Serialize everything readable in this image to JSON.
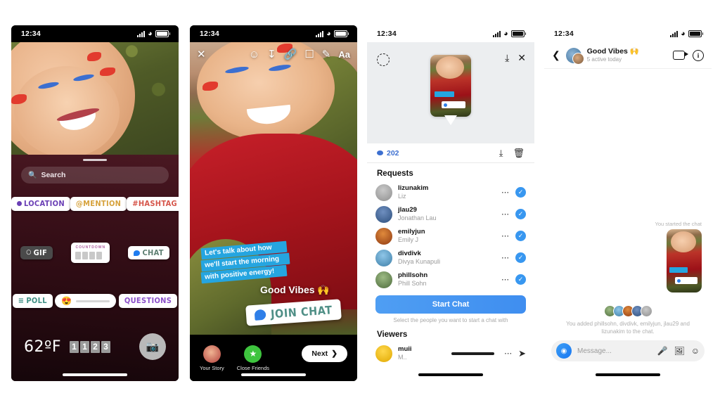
{
  "status_bar": {
    "time": "12:34"
  },
  "phone1": {
    "name": "story-camera-sticker-tray",
    "search": {
      "placeholder": "Search",
      "icon": "search-icon"
    },
    "stickers_row1": [
      {
        "label": "LOCATION",
        "icon": "location-pin-icon",
        "color": "#6a3fb5"
      },
      {
        "label": "@MENTION",
        "color": "#d6a23c"
      },
      {
        "label": "#HASHTAG",
        "color": "#d6564b"
      }
    ],
    "stickers_row2": [
      {
        "label": "GIF",
        "icon": "search-icon",
        "color": "#ffffff"
      },
      {
        "label": "COUNTDOWN",
        "color": "#b05fa0"
      },
      {
        "label": "CHAT",
        "icon": "chat-bubble-icon",
        "color": "#5e7f72"
      }
    ],
    "stickers_row3": [
      {
        "label": "POLL",
        "color": "#3f8f84"
      },
      {
        "label": "",
        "emoji": "😍"
      },
      {
        "label": "QUESTIONS",
        "color": "#8b4fc9"
      }
    ],
    "temperature": "62ºF",
    "clock_digits": [
      "1",
      "1",
      "2",
      "3"
    ],
    "shutter_icon": "camera-icon"
  },
  "phone2": {
    "name": "story-editor",
    "toolbar": {
      "close": "✕",
      "icons": [
        "smiley-face-icon",
        "download-icon",
        "link-icon",
        "sticker-icon",
        "draw-pen-icon"
      ],
      "text_tool": "Aa"
    },
    "text_sticker_lines": [
      "Let's talk about how",
      "we'll start the morning",
      "with positive energy!"
    ],
    "title_sticker": "Good Vibes 🙌",
    "join_chat_label": "JOIN CHAT",
    "footer": {
      "your_story": "Your Story",
      "close_friends": "Close Friends",
      "next": "Next"
    }
  },
  "phone3": {
    "name": "story-viewers-sheet",
    "top_icons": {
      "left": "sticker-circle-icon",
      "save": "save-story-icon",
      "close": "close-icon"
    },
    "view_count": "202",
    "bar_icons": [
      "download-icon",
      "trash-icon"
    ],
    "requests_header": "Requests",
    "requests": [
      {
        "username": "lizunakim",
        "fullname": "Liz"
      },
      {
        "username": "jlau29",
        "fullname": "Jonathan Lau"
      },
      {
        "username": "emilyjun",
        "fullname": "Emily J"
      },
      {
        "username": "divdivk",
        "fullname": "Divya Kunapuli"
      },
      {
        "username": "phillsohn",
        "fullname": "Phill Sohn"
      }
    ],
    "start_chat_label": "Start Chat",
    "hint": "Select the people you want to start a chat with",
    "viewers_header": "Viewers",
    "viewers": [
      {
        "username": "muii",
        "fullname": "M.."
      }
    ]
  },
  "phone4": {
    "name": "group-chat",
    "back_icon": "chevron-left-icon",
    "title": "Good Vibes 🙌",
    "subtitle": "5 active today",
    "header_icons": [
      "video-call-icon",
      "info-icon"
    ],
    "started_label": "You started the chat",
    "system_message": "You added phillsohn, divdivk, emilyjun, jlau29 and lizunakim to the chat.",
    "composer": {
      "camera_icon": "camera-icon",
      "placeholder": "Message...",
      "icons": [
        "microphone-icon",
        "photo-icon",
        "sticker-icon"
      ]
    }
  }
}
